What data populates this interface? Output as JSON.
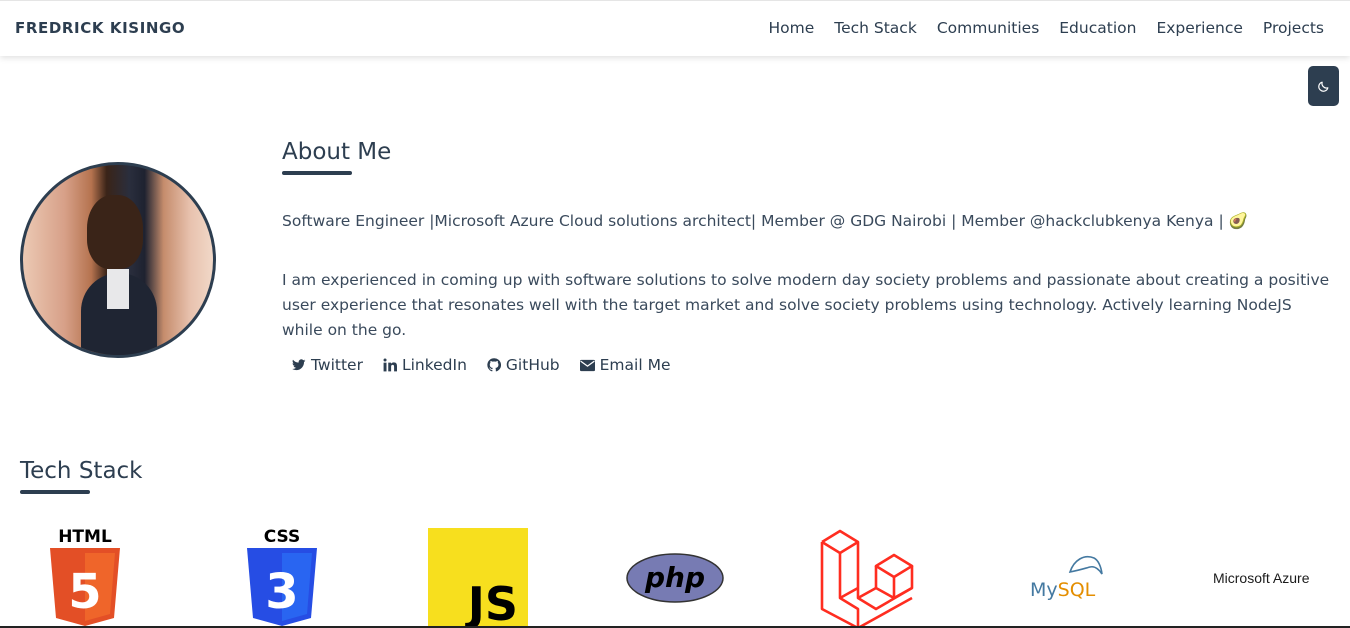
{
  "nav": {
    "brand": "FREDRICK KISINGO",
    "links": [
      "Home",
      "Tech Stack",
      "Communities",
      "Education",
      "Experience",
      "Projects"
    ]
  },
  "theme_toggle": {
    "icon": "moon-icon"
  },
  "about": {
    "title": "About Me",
    "tagline": "Software Engineer |Microsoft Azure Cloud solutions architect| Member @ GDG Nairobi | Member @hackclubkenya Kenya | 🥑",
    "bio": "I am experienced in coming up with software solutions to solve modern day society problems and passionate about creating a positive user experience that resonates well with the target market and solve society problems using technology. Actively learning NodeJS while on the go.",
    "social": [
      {
        "label": "Twitter",
        "icon": "twitter-icon"
      },
      {
        "label": "LinkedIn",
        "icon": "linkedin-icon"
      },
      {
        "label": "GitHub",
        "icon": "github-icon"
      },
      {
        "label": "Email Me",
        "icon": "email-icon"
      }
    ]
  },
  "tech_stack": {
    "title": "Tech Stack",
    "items": [
      {
        "name": "HTML",
        "logo_text": "HTML",
        "digit": "5"
      },
      {
        "name": "CSS",
        "logo_text": "CSS",
        "digit": "3"
      },
      {
        "name": "JavaScript",
        "logo_text": "JS"
      },
      {
        "name": "PHP",
        "logo_text": "php"
      },
      {
        "name": "Laravel"
      },
      {
        "name": "MySQL",
        "logo_text_a": "My",
        "logo_text_b": "SQL"
      },
      {
        "name": "Microsoft Azure",
        "logo_text": "Microsoft Azure"
      }
    ]
  },
  "colors": {
    "primary": "#2d3e50",
    "html": "#e34f26",
    "css": "#264de4",
    "js": "#f7df1e",
    "php": "#777bb3",
    "laravel": "#ff2d20"
  }
}
